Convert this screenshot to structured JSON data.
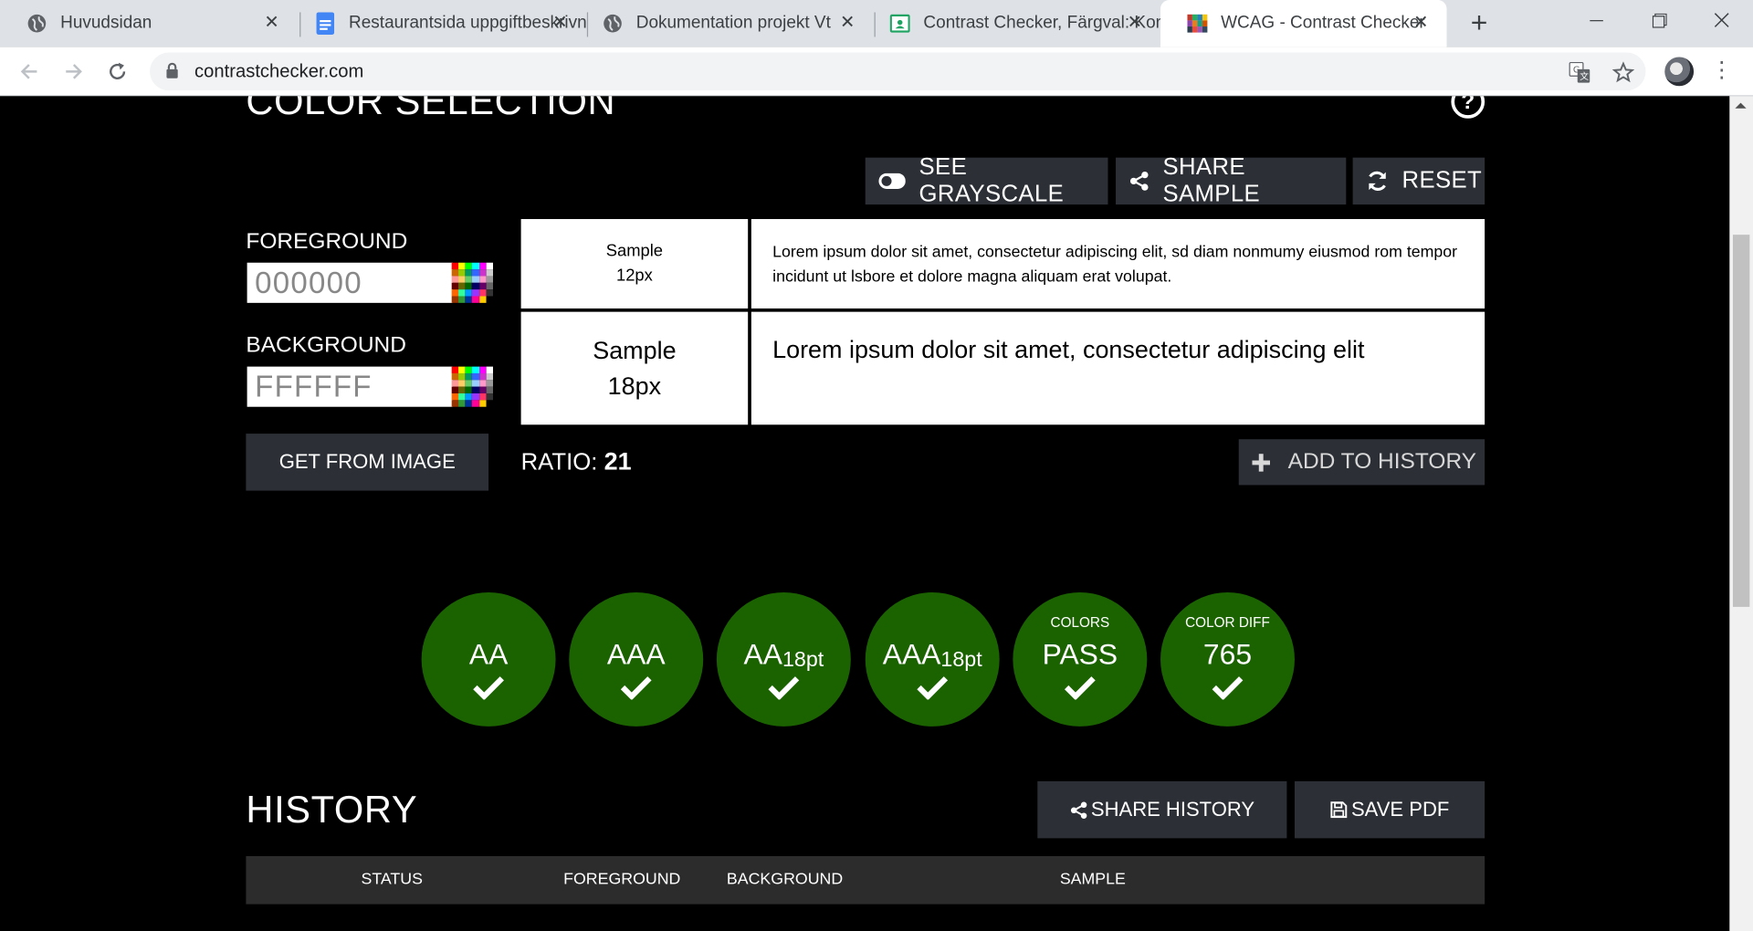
{
  "browser": {
    "tabs": [
      {
        "title": "Huvudsidan",
        "icon": "globe-icon"
      },
      {
        "title": "Restaurantsida uppgiftbeskrivning",
        "icon": "google-docs-icon"
      },
      {
        "title": "Dokumentation projekt Vt",
        "icon": "globe-icon"
      },
      {
        "title": "Contrast Checker, Färgval: Kontrast",
        "icon": "classroom-icon"
      },
      {
        "title": "WCAG - Contrast Checker",
        "icon": "contrastchecker-favicon"
      }
    ],
    "url": "contrastchecker.com"
  },
  "page": {
    "section_title": "COLOR SELECTION",
    "tools": {
      "grayscale": "SEE GRAYSCALE",
      "share_sample": "SHARE SAMPLE",
      "reset": "RESET"
    },
    "foreground": {
      "label": "FOREGROUND",
      "value": "000000"
    },
    "background": {
      "label": "BACKGROUND",
      "value": "FFFFFF"
    },
    "get_from_image": "GET FROM IMAGE",
    "samples": {
      "small_label_1": "Sample",
      "small_label_2": "12px",
      "small_text": "Lorem ipsum dolor sit amet, consectetur adipiscing elit, sd diam nonmumy eiusmod rom tempor incidunt ut lsbore et dolore magna aliquam erat volupat.",
      "large_label_1": "Sample",
      "large_label_2": "18px",
      "large_text": "Lorem ipsum dolor sit amet, consectetur adipiscing elit"
    },
    "ratio_label": "RATIO:",
    "ratio_value": "21",
    "add_to_history": "ADD TO HISTORY",
    "badges": [
      {
        "small": "",
        "main": "AA",
        "sub": "",
        "status": "pass"
      },
      {
        "small": "",
        "main": "AAA",
        "sub": "",
        "status": "pass"
      },
      {
        "small": "",
        "main": "AA",
        "sub": "18pt",
        "status": "pass"
      },
      {
        "small": "",
        "main": "AAA",
        "sub": "18pt",
        "status": "pass"
      },
      {
        "small": "COLORS",
        "main": "PASS",
        "sub": "",
        "status": "pass"
      },
      {
        "small": "COLOR DIFF",
        "main": "765",
        "sub": "",
        "status": "pass"
      }
    ],
    "badge_color": "#1b6300",
    "history": {
      "title": "HISTORY",
      "share": "SHARE HISTORY",
      "save_pdf": "SAVE PDF",
      "columns": [
        "STATUS",
        "FOREGROUND",
        "BACKGROUND",
        "SAMPLE"
      ]
    }
  }
}
